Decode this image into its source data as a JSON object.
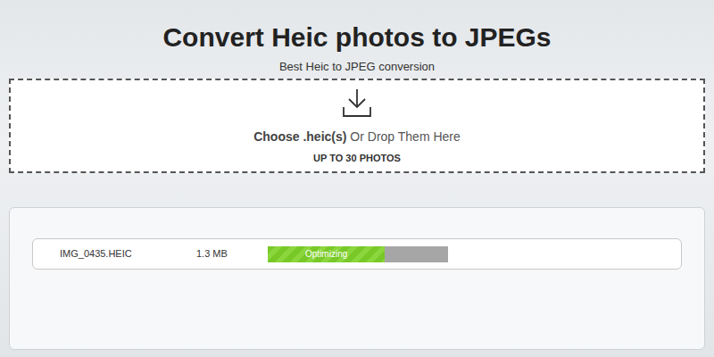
{
  "page": {
    "title": "Convert Heic photos to JPEGs",
    "subtitle": "Best Heic to JPEG conversion"
  },
  "dropzone": {
    "choose": "Choose .heic(s)",
    "rest": "Or Drop Them Here",
    "limit": "UP TO 30 PHOTOS"
  },
  "files": [
    {
      "name": "IMG_0435.HEIC",
      "size": "1.3 MB",
      "status": "Optimizing",
      "level": 0.65
    }
  ]
}
